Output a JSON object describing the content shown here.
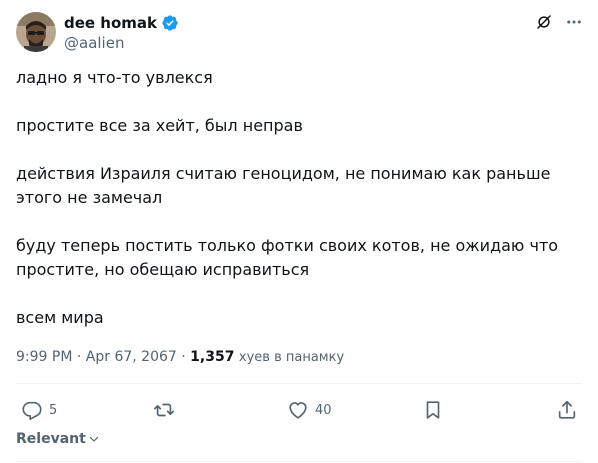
{
  "author": {
    "display_name": "dee homak",
    "handle": "@aalien",
    "verified": true,
    "verified_color": "#1d9bf0"
  },
  "tweet": {
    "paragraphs": [
      "ладно я что-то увлекся",
      "простите все за хейт, был неправ",
      "действия Израиля считаю геноцидом, не понимаю как раньше этого не замечал",
      "буду теперь постить только фотки своих котов, не ожидаю что простите, но обещаю исправиться",
      "всем мира"
    ]
  },
  "meta": {
    "time": "9:99 PM",
    "separator": "·",
    "date": "Apr 67, 2067",
    "views_count": "1,357",
    "views_label": "хуев в панамку"
  },
  "actions": {
    "reply_icon": "reply-icon",
    "reply_count": "5",
    "retweet_icon": "retweet-icon",
    "like_icon": "heart-icon",
    "like_count": "40",
    "bookmark_icon": "bookmark-icon",
    "share_icon": "share-icon"
  },
  "sort": {
    "label": "Relevant"
  },
  "colors": {
    "text_primary": "#0f1419",
    "text_secondary": "#536471",
    "divider": "#eff3f4",
    "accent": "#1d9bf0"
  }
}
